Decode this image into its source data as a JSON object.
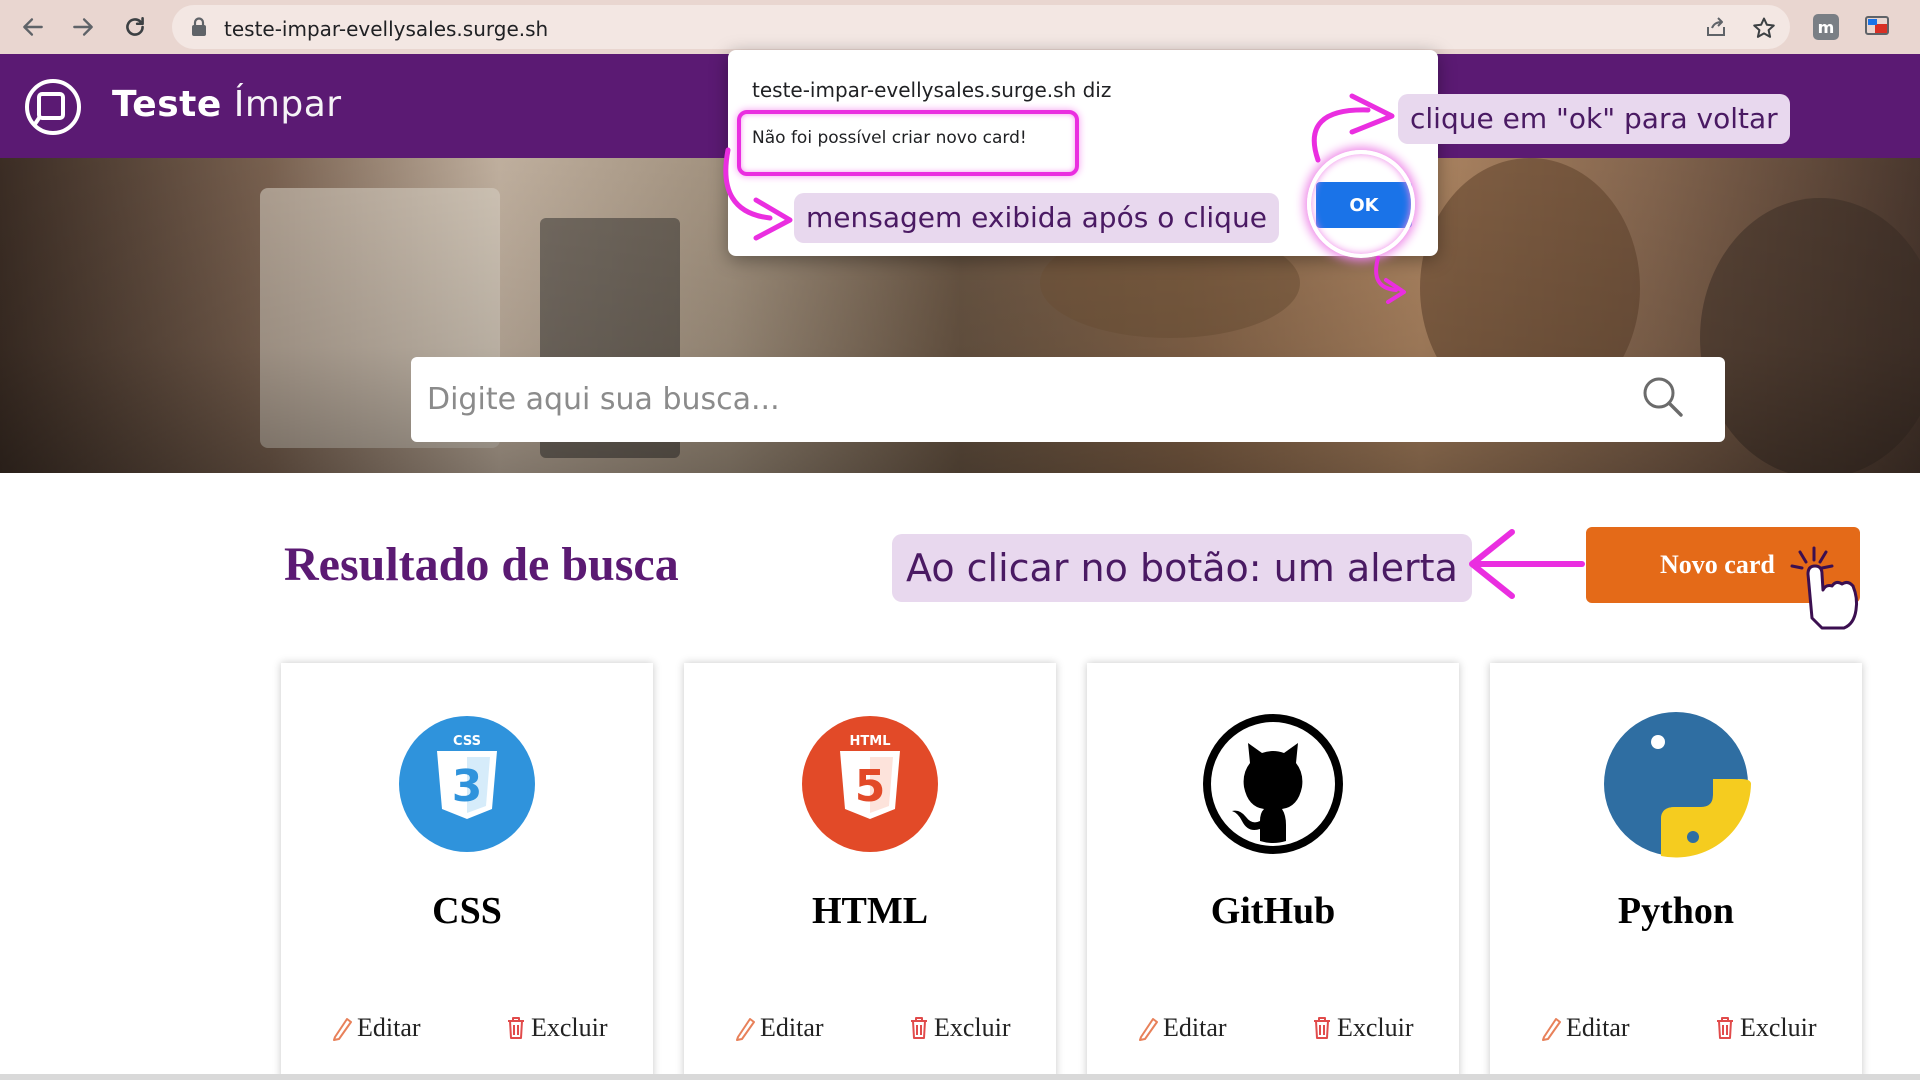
{
  "browser": {
    "url": "teste-impar-evellysales.surge.sh",
    "icons": [
      "back-arrow-icon",
      "forward-arrow-icon",
      "reload-icon",
      "lock-icon",
      "share-icon",
      "star-icon",
      "extension-m-icon",
      "extension-cast-icon"
    ]
  },
  "header": {
    "logo_bold": "Teste",
    "logo_light": "Ímpar"
  },
  "search": {
    "placeholder": "Digite aqui sua busca..."
  },
  "results": {
    "title": "Resultado de busca",
    "new_card_label": "Novo card"
  },
  "cards": [
    {
      "title": "CSS",
      "icon": "css3-icon",
      "edit_label": "Editar",
      "delete_label": "Excluir"
    },
    {
      "title": "HTML",
      "icon": "html5-icon",
      "edit_label": "Editar",
      "delete_label": "Excluir"
    },
    {
      "title": "GitHub",
      "icon": "github-icon",
      "edit_label": "Editar",
      "delete_label": "Excluir"
    },
    {
      "title": "Python",
      "icon": "python-icon",
      "edit_label": "Editar",
      "delete_label": "Excluir"
    }
  ],
  "alert": {
    "origin": "teste-impar-evellysales.surge.sh diz",
    "message": "Não foi possível criar novo card!",
    "ok_label": "OK"
  },
  "annotations": {
    "click_ok": "clique em \"ok\" para voltar",
    "message_shown": "mensagem exibida após o clique",
    "button_alert": "Ao clicar no botão: um alerta"
  },
  "colors": {
    "header_purple": "#5b1a73",
    "button_orange": "#e46a18",
    "ok_blue": "#1a73e8",
    "highlight_pink": "#ea2ee0",
    "note_bg": "#e8d8ee"
  }
}
